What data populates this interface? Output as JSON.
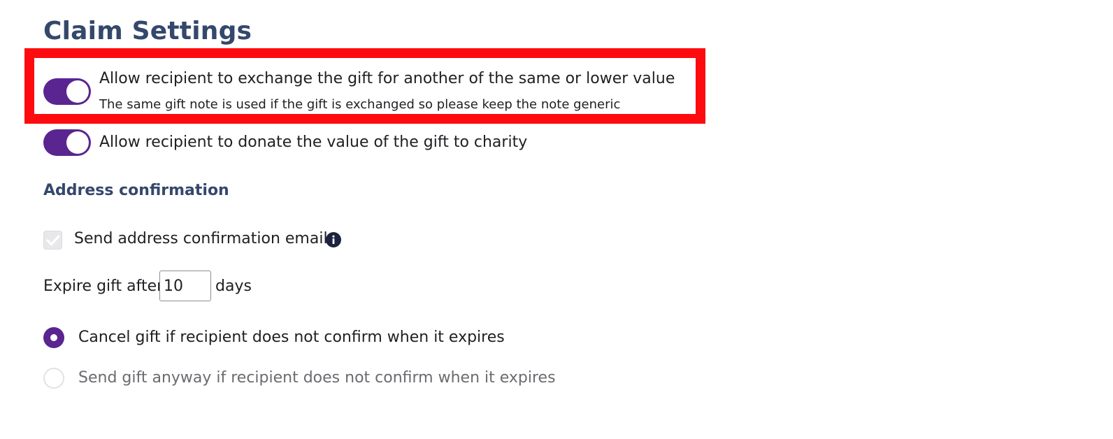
{
  "header": {
    "title": "Claim Settings"
  },
  "exchange_option": {
    "label": "Allow recipient to exchange the gift for another of the same or lower value",
    "sublabel": "The same gift note is used if the gift is exchanged so please keep the note generic",
    "enabled": true
  },
  "donate_option": {
    "label": "Allow recipient to donate the value of the gift to charity",
    "enabled": true
  },
  "address_confirmation": {
    "heading": "Address confirmation",
    "send_email_label": "Send address confirmation email",
    "send_email_checked": true,
    "send_email_disabled": true,
    "info_icon": "info-icon"
  },
  "expiry": {
    "before_label": "Expire gift after",
    "days_value": "10",
    "after_label": "days"
  },
  "expiry_action": {
    "options": [
      {
        "label": "Cancel gift if recipient does not confirm when it expires",
        "selected": true
      },
      {
        "label": "Send gift anyway if recipient does not confirm when it expires",
        "selected": false
      }
    ]
  },
  "colors": {
    "accent": "#5a2590",
    "heading": "#34486b",
    "highlight": "#fe0b10",
    "text": "#1f1f24",
    "muted_text": "#6b6b70"
  }
}
